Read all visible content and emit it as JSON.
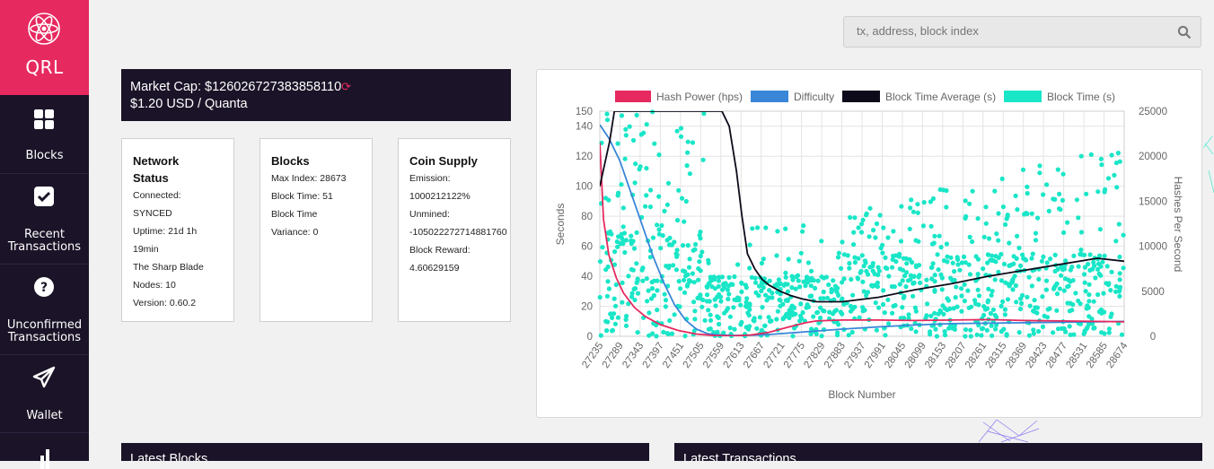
{
  "app": {
    "name": "QRL"
  },
  "sidebar": {
    "items": [
      {
        "label": "Blocks",
        "icon": "grid-icon"
      },
      {
        "label_line1": "Recent",
        "label_line2": "Transactions",
        "icon": "check-square-icon"
      },
      {
        "label_line1": "Unconfirmed",
        "label_line2": "Transactions",
        "icon": "question-circle-icon"
      },
      {
        "label": "Wallet",
        "icon": "paper-plane-icon"
      },
      {
        "icon": "bar-chart-icon"
      }
    ]
  },
  "search": {
    "placeholder": "tx, address, block index"
  },
  "market": {
    "cap": "Market Cap: $126026727383858110",
    "price": "$1.20 USD / Quanta"
  },
  "network": {
    "title": "Network Status",
    "lines": [
      "Connected:",
      "SYNCED",
      "Uptime: 21d 1h",
      "19min",
      "The Sharp Blade",
      "Nodes: 10",
      "Version: 0.60.2"
    ]
  },
  "blocks": {
    "title": "Blocks",
    "lines": [
      "Max Index: 28673",
      "Block Time: 51",
      "Block Time",
      "Variance: 0"
    ]
  },
  "supply": {
    "title": "Coin Supply",
    "lines": [
      "Emission:",
      "1000212122%",
      "Unmined:",
      "-105022272714881760",
      "Block Reward:",
      "4.60629159"
    ]
  },
  "chart_data": {
    "type": "line",
    "xlabel": "Block Number",
    "ylabel_left": "Seconds",
    "ylabel_right": "Hashes Per Second",
    "ylim_left": [
      0,
      150
    ],
    "ylim_right": [
      0,
      25000
    ],
    "yticks_left": [
      0,
      20,
      40,
      60,
      80,
      100,
      120,
      140,
      150
    ],
    "yticks_right": [
      0,
      5000,
      10000,
      15000,
      20000,
      25000
    ],
    "xlim": [
      27235,
      28674
    ],
    "xticks": [
      "27235",
      "27289",
      "27343",
      "27397",
      "27451",
      "27505",
      "27559",
      "27613",
      "27667",
      "27721",
      "27775",
      "27829",
      "27883",
      "27937",
      "27991",
      "28045",
      "28099",
      "28153",
      "28207",
      "28261",
      "28315",
      "28369",
      "28423",
      "28477",
      "28531",
      "28585",
      "28674"
    ],
    "legend_position": "top",
    "grid": true,
    "series": [
      {
        "name": "Hash Power (hps)",
        "color": "#e6295f",
        "axis": "right",
        "x": [
          27235,
          27245,
          27260,
          27280,
          27300,
          27330,
          27360,
          27400,
          27450,
          27500,
          27550,
          27600,
          27650,
          27700,
          27750,
          27800,
          27829,
          27900,
          28000,
          28100,
          28200,
          28300,
          28400,
          28500,
          28600,
          28674
        ],
        "y": [
          21500,
          13000,
          9000,
          6500,
          4800,
          3200,
          2200,
          1300,
          650,
          250,
          80,
          30,
          150,
          450,
          1000,
          1500,
          1700,
          1800,
          1800,
          1750,
          1800,
          1850,
          1750,
          1700,
          1650,
          1600
        ]
      },
      {
        "name": "Difficulty",
        "color": "#3a86d8",
        "axis": "right",
        "x": [
          27235,
          27260,
          27290,
          27320,
          27350,
          27380,
          27410,
          27440,
          27470,
          27500,
          27530,
          27560,
          27600,
          27650,
          27700,
          27750,
          27800,
          27850,
          27900,
          28000,
          28100,
          28200,
          28300,
          28400,
          28500,
          28600,
          28674
        ],
        "y": [
          23500,
          22000,
          19500,
          16000,
          12500,
          9000,
          6000,
          3500,
          1800,
          800,
          300,
          150,
          100,
          120,
          200,
          350,
          500,
          650,
          800,
          1050,
          1250,
          1400,
          1450,
          1500,
          1550,
          1600,
          1650
        ]
      },
      {
        "name": "Block Time Average (s)",
        "color": "#0d0b1a",
        "axis": "left",
        "x": [
          27235,
          27262,
          27275,
          27290,
          27420,
          27570,
          27590,
          27610,
          27625,
          27640,
          27660,
          27680,
          27700,
          27730,
          27760,
          27790,
          27830,
          27900,
          28000,
          28100,
          28200,
          28300,
          28400,
          28500,
          28600,
          28674
        ],
        "y": [
          100,
          130,
          150,
          150,
          150,
          150,
          140,
          110,
          80,
          55,
          45,
          38,
          34,
          30,
          27,
          25,
          23,
          23,
          26,
          31,
          35,
          40,
          44,
          48,
          52,
          50
        ]
      },
      {
        "name": "Block Time (s)",
        "color": "#19e6c7",
        "axis": "left",
        "style": "scatter",
        "x": [],
        "y": []
      }
    ]
  },
  "latest_blocks": {
    "title": "Latest Blocks"
  },
  "latest_tx": {
    "title": "Latest Transactions"
  }
}
